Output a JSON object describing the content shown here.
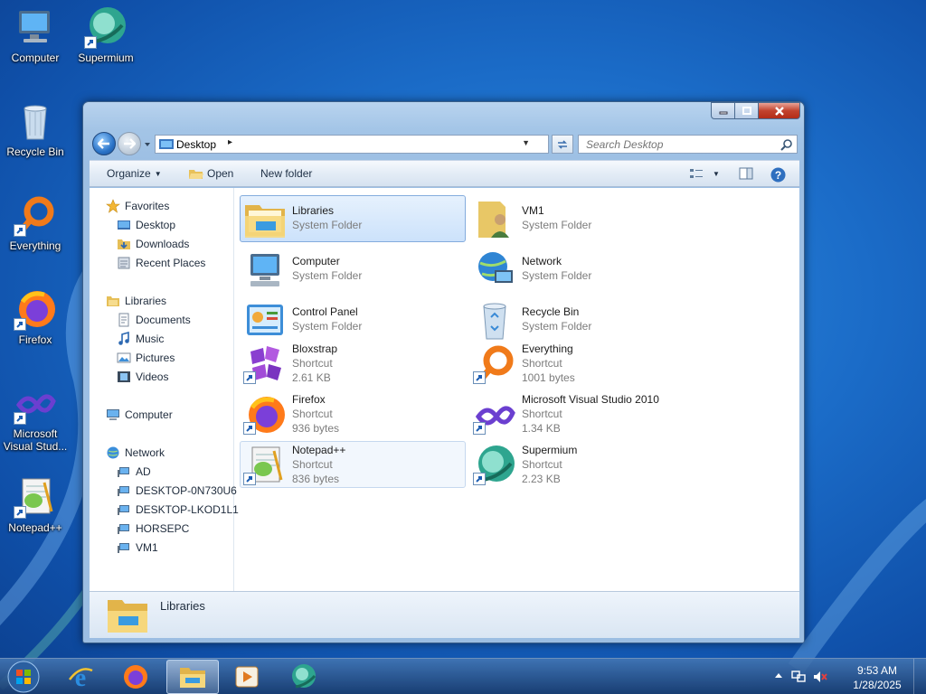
{
  "desktop": {
    "icons": [
      {
        "label": "Computer"
      },
      {
        "label": "Supermium"
      },
      {
        "label": "Recycle Bin"
      },
      {
        "label": "Everything"
      },
      {
        "label": "Firefox"
      },
      {
        "label": "Microsoft Visual Stud..."
      },
      {
        "label": "Notepad++"
      }
    ]
  },
  "window": {
    "address": {
      "crumb": "Desktop",
      "separator": "▸"
    },
    "search": {
      "placeholder": "Search Desktop"
    },
    "toolbar": {
      "organize": "Organize",
      "open": "Open",
      "new_folder": "New folder"
    },
    "nav": {
      "favorites": "Favorites",
      "desktop": "Desktop",
      "downloads": "Downloads",
      "recent": "Recent Places",
      "libraries": "Libraries",
      "documents": "Documents",
      "music": "Music",
      "pictures": "Pictures",
      "videos": "Videos",
      "computer": "Computer",
      "network": "Network",
      "net_ad": "AD",
      "net_0n": "DESKTOP-0N730U6",
      "net_lk": "DESKTOP-LKOD1L1",
      "net_horse": "HORSEPC",
      "net_vm1": "VM1"
    },
    "files": [
      {
        "name": "Libraries",
        "type": "System Folder",
        "size": ""
      },
      {
        "name": "VM1",
        "type": "System Folder",
        "size": ""
      },
      {
        "name": "Computer",
        "type": "System Folder",
        "size": ""
      },
      {
        "name": "Network",
        "type": "System Folder",
        "size": ""
      },
      {
        "name": "Control Panel",
        "type": "System Folder",
        "size": ""
      },
      {
        "name": "Recycle Bin",
        "type": "System Folder",
        "size": ""
      },
      {
        "name": "Bloxstrap",
        "type": "Shortcut",
        "size": "2.61 KB"
      },
      {
        "name": "Everything",
        "type": "Shortcut",
        "size": "1001 bytes"
      },
      {
        "name": "Firefox",
        "type": "Shortcut",
        "size": "936 bytes"
      },
      {
        "name": "Microsoft Visual Studio 2010",
        "type": "Shortcut",
        "size": "1.34 KB"
      },
      {
        "name": "Notepad++",
        "type": "Shortcut",
        "size": "836 bytes"
      },
      {
        "name": "Supermium",
        "type": "Shortcut",
        "size": "2.23 KB"
      }
    ],
    "details": {
      "name": "Libraries"
    }
  },
  "taskbar": {
    "clock": {
      "time": "9:53 AM",
      "date": "1/28/2025"
    }
  }
}
